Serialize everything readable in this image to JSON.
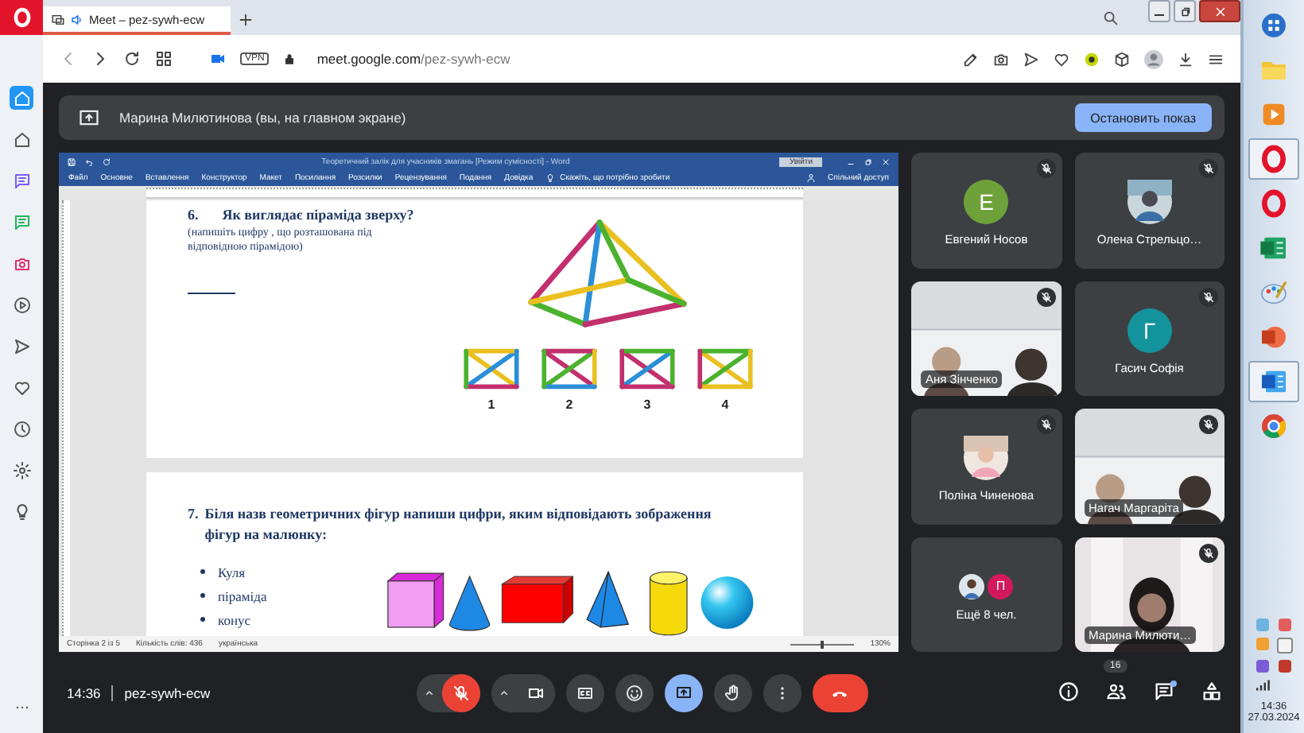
{
  "browser": {
    "tab": {
      "title": "Meet – pez-sywh-ecw",
      "playing_audio": true
    },
    "address": {
      "host": "meet.google.com",
      "path": "/pez-sywh-ecw",
      "vpn": "VPN"
    }
  },
  "sidebar": [
    {
      "kind": "home",
      "selected": true
    },
    {
      "kind": "house",
      "selected": false
    },
    {
      "kind": "messenger",
      "selected": false
    },
    {
      "kind": "whatsapp",
      "selected": false
    },
    {
      "kind": "instagram",
      "selected": false
    },
    {
      "kind": "play",
      "selected": false
    },
    {
      "kind": "send",
      "selected": false
    },
    {
      "kind": "heart",
      "selected": false
    },
    {
      "kind": "clock",
      "selected": false
    },
    {
      "kind": "gear",
      "selected": false
    },
    {
      "kind": "bulb",
      "selected": false
    }
  ],
  "banner": {
    "text": "Марина Милютинова (вы, на главном экране)",
    "button": "Остановить показ"
  },
  "word": {
    "title": "Теоретичний залік для учасників змагань [Режим сумісності]  -  Word",
    "sign_in": "Увійти",
    "ribbon_tabs": [
      "Файл",
      "Основне",
      "Вставлення",
      "Конструктор",
      "Макет",
      "Посилання",
      "Розсилки",
      "Рецензування",
      "Подання",
      "Довідка"
    ],
    "tell_me": "Скажіть, що потрібно зробити",
    "share": "Спільний доступ",
    "status": {
      "page": "Сторінка 2 із 5",
      "words": "Кількість слів: 436",
      "language": "українська",
      "zoom": "130%",
      "zoom_slider": {
        "level": 0.5
      }
    }
  },
  "document": {
    "q6": {
      "number": "6.",
      "title": "Як виглядає піраміда зверху?",
      "hint": "(напишіть цифру , що розташована під відповідною пірамідою)",
      "options": [
        "1",
        "2",
        "3",
        "4"
      ]
    },
    "q7": {
      "number": "7.",
      "text": "Біля назв геометричних фігур напиши цифри, яким відповідають зображення фігур на малюнку:",
      "items": [
        "Куля",
        "піраміда",
        "конус"
      ]
    }
  },
  "participants": [
    {
      "kind": "letter",
      "name": "Евгений Носов",
      "letter": "Е",
      "color": "#6ea13a",
      "muted": true
    },
    {
      "name": "Олена Стрельцо…",
      "muted": true
    },
    {
      "kind": "video",
      "name": "Аня Зінченко",
      "muted": true
    },
    {
      "kind": "letter",
      "name": "Гасич Софія",
      "letter": "Г",
      "color": "#13939c",
      "muted": true
    },
    {
      "name": "Поліна Чиненова",
      "muted": true
    },
    {
      "kind": "video",
      "name": "Нагач Маргаріта",
      "muted": true
    },
    {
      "kind": "more",
      "name": "Ещё 8 чел.",
      "letter": "П",
      "color": "#d3195c",
      "muted": false
    },
    {
      "kind": "video",
      "name": "Марина Милюти…",
      "muted": true
    }
  ],
  "call": {
    "time": "14:36",
    "code": "pez-sywh-ecw",
    "controls": [
      {
        "kind": "mic",
        "muted": true
      },
      {
        "kind": "camera",
        "muted": false
      },
      {
        "kind": "captions",
        "on": false
      },
      {
        "kind": "reactions",
        "on": false
      },
      {
        "kind": "present",
        "on": true
      },
      {
        "kind": "hand",
        "on": false
      },
      {
        "kind": "more",
        "on": false
      },
      {
        "kind": "hangup"
      }
    ],
    "people_count": "16",
    "chat_unread": true
  },
  "taskbar": {
    "apps": [
      {
        "kind": "orb",
        "selected": false
      },
      {
        "kind": "folder",
        "selected": false
      },
      {
        "kind": "media",
        "selected": false
      },
      {
        "kind": "browser-o",
        "selected": true
      },
      {
        "kind": "browser-o",
        "selected": false
      },
      {
        "kind": "sheet",
        "selected": false
      },
      {
        "kind": "palette",
        "selected": false
      },
      {
        "kind": "slides",
        "selected": false
      },
      {
        "kind": "document",
        "selected": true
      },
      {
        "kind": "browser-c",
        "selected": false
      }
    ],
    "time": "14:36",
    "date": "27.03.2024"
  }
}
